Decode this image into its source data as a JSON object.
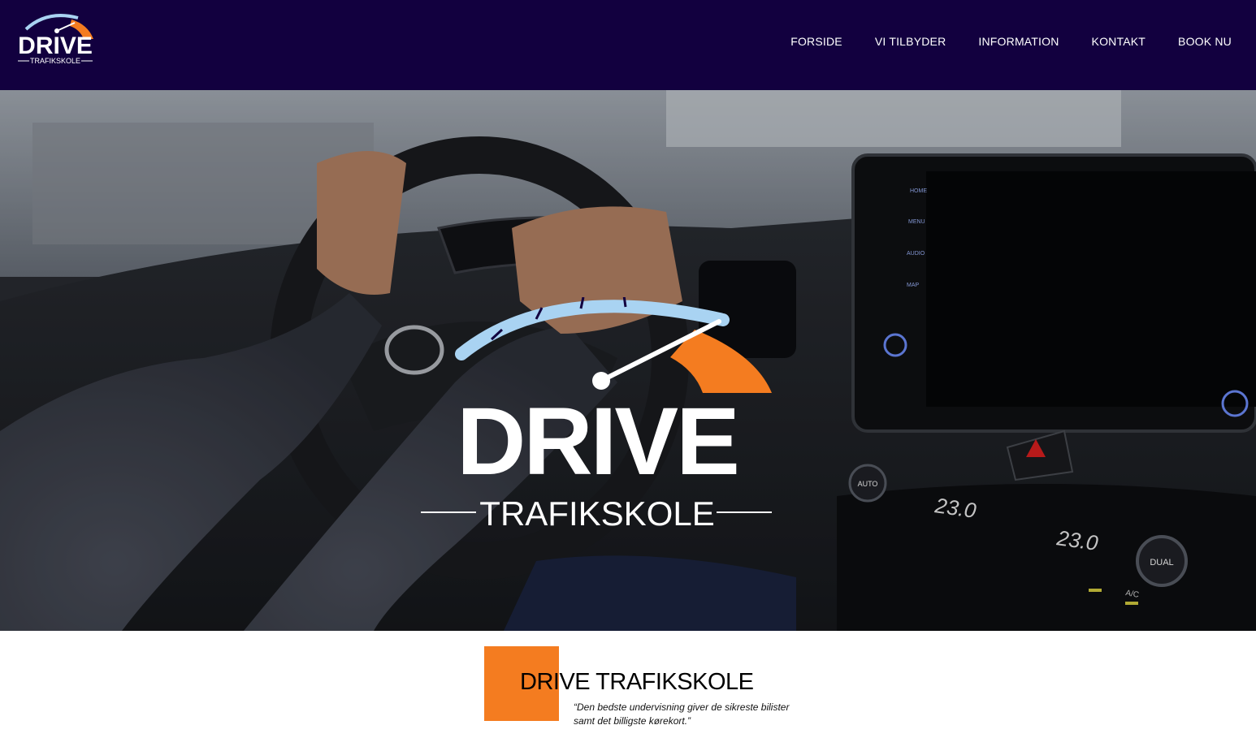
{
  "header": {
    "logo": {
      "wordmark": "DRIVE",
      "subtitle": "TRAFIKSKOLE"
    },
    "nav": [
      {
        "label": "FORSIDE"
      },
      {
        "label": "VI TILBYDER"
      },
      {
        "label": "INFORMATION"
      },
      {
        "label": "KONTAKT"
      },
      {
        "label": "BOOK NU"
      }
    ]
  },
  "hero": {
    "logo": {
      "wordmark": "DRIVE",
      "subtitle": "TRAFIKSKOLE"
    },
    "dashboard": {
      "buttons": [
        "HOME",
        "MENU",
        "AUDIO",
        "MAP"
      ],
      "temp_left": "23.0",
      "temp_right": "23.0",
      "auto_label": "AUTO",
      "dual_label": "DUAL",
      "ac_label": "A/C"
    }
  },
  "intro": {
    "title": "DRIVE TRAFIKSKOLE",
    "tagline": "“Den bedste undervisning giver de sikreste bilister samt det billigste kørekort.”"
  },
  "colors": {
    "header_bg": "#12003f",
    "accent_orange": "#f47c20",
    "logo_blue": "#a9d3f2"
  }
}
